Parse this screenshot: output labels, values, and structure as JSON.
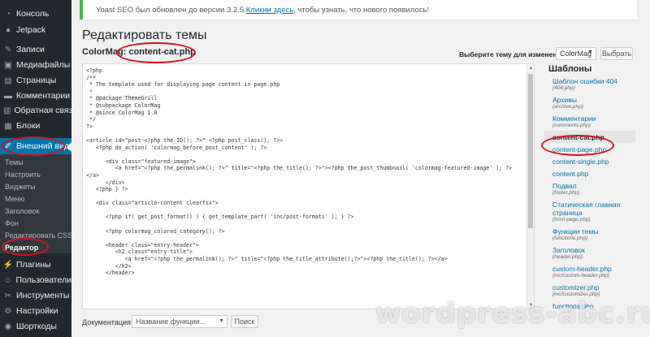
{
  "sidebar": {
    "items": [
      {
        "label": "Консоль",
        "icon": "dashboard-icon",
        "glyph": "◔"
      },
      {
        "label": "Jetpack",
        "icon": "jetpack-icon",
        "glyph": "●"
      },
      {
        "label": "Записи",
        "icon": "pin-icon",
        "glyph": "✎"
      },
      {
        "label": "Медиафайлы",
        "icon": "media-icon",
        "glyph": "▣"
      },
      {
        "label": "Страницы",
        "icon": "pages-icon",
        "glyph": "▤"
      },
      {
        "label": "Комментарии",
        "icon": "comments-icon",
        "glyph": "▬"
      },
      {
        "label": "Обратная связь",
        "icon": "feedback-icon",
        "glyph": "▥"
      },
      {
        "label": "Блоки",
        "icon": "blocks-icon",
        "glyph": "▦"
      },
      {
        "label": "Внешний вид",
        "icon": "appearance-icon",
        "glyph": "✐"
      },
      {
        "label": "Плагины",
        "icon": "plugins-icon",
        "glyph": "⚡"
      },
      {
        "label": "Пользователи",
        "icon": "users-icon",
        "glyph": "☺"
      },
      {
        "label": "Инструменты",
        "icon": "tools-icon",
        "glyph": "✂"
      },
      {
        "label": "Настройки",
        "icon": "settings-icon",
        "glyph": "⚙"
      },
      {
        "label": "Шорткоды",
        "icon": "shortcodes-icon",
        "glyph": "◉"
      }
    ],
    "submenu": [
      "Темы",
      "Настроить",
      "Виджеты",
      "Меню",
      "Заголовок",
      "Фон",
      "Редактировать CSS",
      "Редактор"
    ]
  },
  "notice": {
    "before": "Yoast SEO был обновлен до версии 3.2.5. ",
    "link": "Кликни здесь",
    "after": ", чтобы узнать, что нового появилось!"
  },
  "page": {
    "title": "Редактировать темы",
    "theme_name": "ColorMag:",
    "file_name": "content-cat.php",
    "select_label": "Выберите тему для изменения:",
    "selected_theme": "ColorMag",
    "select_button": "Выбрать"
  },
  "editor": {
    "code": "<?php\n/**\n * The template used for displaying page content in page.php\n *\n * @package ThemeGrill\n * @subpackage ColorMag\n * @since ColorMag 1.0\n */\n?>\n\n<article id=\"post-<?php the_ID(); ?>\" <?php post_class(); ?>>\n   <?php do_action( 'colormag_before_post_content' ); ?>\n\n      <div class=\"featured-image\">\n         <a href=\"<?php the_permalink(); ?>\" title=\"<?php the_title(); ?>\"><?php the_post_thumbnail( 'colormag-featured-image' ); ?>\n</a>\n      </div>\n   <?php } ?>\n\n   <div class=\"article-content clearfix\">\n\n      <?php if( get_post_format() ) { get_template_part( 'inc/post-formats' ); } ?>\n\n      <?php colormag_colored_category(); ?>\n\n      <header class=\"entry-header\">\n         <h2 class=\"entry-title\">\n            <a href=\"<?php the_permalink(); ?>\" title=\"<?php the_title_attribute();?>\"><?php the_title(); ?></a>\n         </h2>\n      </header>"
  },
  "documentation": {
    "label": "Документация:",
    "placeholder": "Название функции...",
    "button": "Поиск"
  },
  "templates": {
    "title": "Шаблоны",
    "items": [
      {
        "name": "Шаблон ошибки 404",
        "file": "(404.php)"
      },
      {
        "name": "Архивы",
        "file": "(archive.php)"
      },
      {
        "name": "Комментарии",
        "file": "(comments.php)"
      },
      {
        "name": "content-cat.php",
        "file": ""
      },
      {
        "name": "content-page.php",
        "file": ""
      },
      {
        "name": "content-single.php",
        "file": ""
      },
      {
        "name": "content.php",
        "file": ""
      },
      {
        "name": "Подвал",
        "file": "(footer.php)"
      },
      {
        "name": "Статическая главная страница",
        "file": "(front-page.php)"
      },
      {
        "name": "Функции темы",
        "file": "(functions.php)"
      },
      {
        "name": "Заголовок",
        "file": "(header.php)"
      },
      {
        "name": "custom-header.php",
        "file": "(inc/custom-header.php)"
      },
      {
        "name": "customizer.php",
        "file": "(inc/customizer.php)"
      },
      {
        "name": "functions.php",
        "file": ""
      }
    ]
  },
  "watermark": "wordpress-abc.ru",
  "colors": {
    "accent": "#0073aa",
    "annotation": "#d3121f",
    "sidebar": "#23282d"
  }
}
